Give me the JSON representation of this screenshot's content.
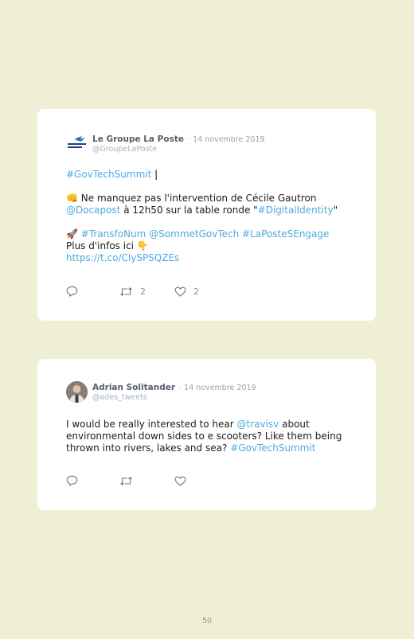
{
  "tweets": [
    {
      "author": "Le Groupe La Poste",
      "date": "· 14 novembre 2019",
      "handle": "@GroupeLaPoste",
      "body": {
        "l1_tag": "#GovTechSummit",
        "l1_cursor": " |",
        "l2_emoji": "👊",
        "l2_text": " Ne manquez pas l'intervention de Cécile Gautron",
        "l3_mention": "@Docapost",
        "l3_text": " à 12h50 sur la table ronde \"",
        "l3_tag": "#DigitalIdentity",
        "l3_end": "\"",
        "l4_emoji": "🚀",
        "l4_tags": " #TransfoNum @SommetGovTech #LaPosteSEngage",
        "l5_text": "Plus d'infos ici ",
        "l5_emoji": "👇",
        "l6_link": "https://t.co/ClySPSQZEs"
      },
      "retweets": "2",
      "likes": "2",
      "avatar_icon": "la-poste-logo"
    },
    {
      "author": "Adrian Solitander",
      "date": "· 14 novembre 2019",
      "handle": "@ades_tweets",
      "body": {
        "l1_text": "I would be really interested to hear ",
        "l1_mention": "@travisv",
        "l1_end": " about",
        "l2_text": "environmental down sides to e scooters? Like them being",
        "l3_text": "thrown into rivers, lakes and sea? ",
        "l3_tag": "#GovTechSummit"
      },
      "avatar_icon": "user-photo"
    }
  ],
  "page_number": "50",
  "colors": {
    "background": "#eeefd4",
    "link": "#4fa9e0",
    "card": "#ffffff"
  }
}
